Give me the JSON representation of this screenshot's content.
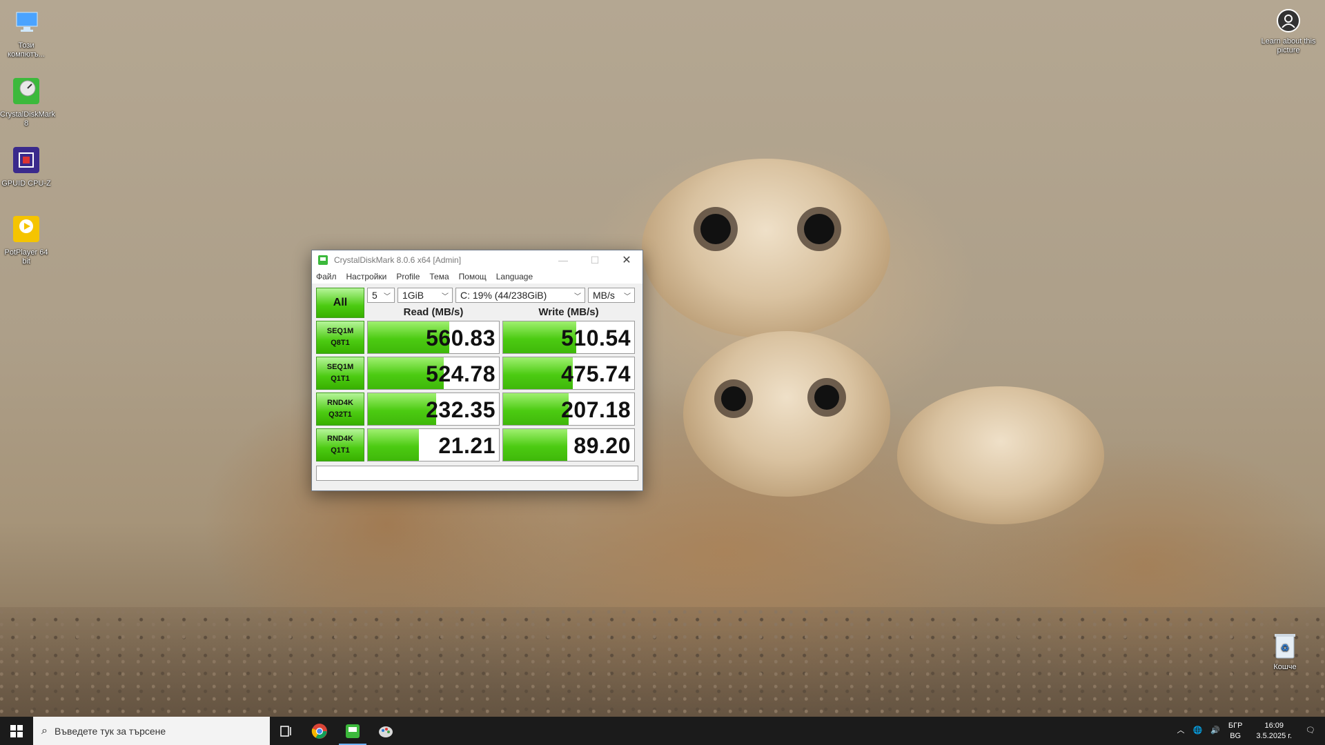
{
  "desktop": {
    "icons": [
      {
        "label": "Този компютъ...",
        "icon": "this-pc-icon"
      },
      {
        "label": "CrystalDiskMark 8",
        "icon": "crystaldiskmark-icon"
      },
      {
        "label": "GPUID CPU-Z",
        "icon": "cpu-z-icon"
      },
      {
        "label": "PotPlayer 64 bit",
        "icon": "potplayer-icon"
      }
    ],
    "learn_about": "Learn about this picture",
    "recycle_bin": "Кошче"
  },
  "window": {
    "title": "CrystalDiskMark 8.0.6 x64 [Admin]",
    "controls": {
      "minimize": "—",
      "maximize": "☐",
      "close": "✕"
    },
    "menu": [
      "Файл",
      "Настройки",
      "Profile",
      "Тема",
      "Помощ",
      "Language"
    ],
    "all_button": "All",
    "count_select": "5",
    "size_select": "1GiB",
    "drive_select": "C: 19% (44/238GiB)",
    "unit_select": "MB/s",
    "headers": {
      "read": "Read (MB/s)",
      "write": "Write (MB/s)"
    },
    "rows": [
      {
        "line1": "SEQ1M",
        "line2": "Q8T1",
        "read": "560.83",
        "write": "510.54",
        "read_pct": 0.62,
        "write_pct": 0.56
      },
      {
        "line1": "SEQ1M",
        "line2": "Q1T1",
        "read": "524.78",
        "write": "475.74",
        "read_pct": 0.58,
        "write_pct": 0.53
      },
      {
        "line1": "RND4K",
        "line2": "Q32T1",
        "read": "232.35",
        "write": "207.18",
        "read_pct": 0.52,
        "write_pct": 0.5
      },
      {
        "line1": "RND4K",
        "line2": "Q1T1",
        "read": "21.21",
        "write": "89.20",
        "read_pct": 0.39,
        "write_pct": 0.49
      }
    ],
    "status_text": ""
  },
  "taskbar": {
    "search_placeholder": "Въведете тук за търсене",
    "language_top": "БГР",
    "language_bottom": "BG",
    "time": "16:09",
    "date": "3.5.2025 г."
  },
  "colors": {
    "accent_green": "#4ccb12",
    "taskbar": "#1b1b1b"
  }
}
